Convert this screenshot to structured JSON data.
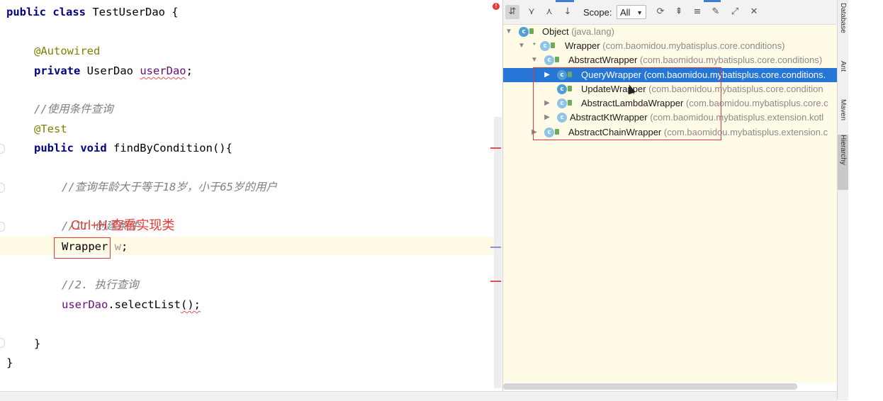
{
  "editor": {
    "lines": {
      "class_decl": {
        "kw": "public class ",
        "name": "TestUserDao {"
      },
      "autowired": "@Autowired",
      "field_decl": {
        "kw": "private ",
        "type": "UserDao ",
        "name": "userDao",
        "semi": ";"
      },
      "comment_use": "//使用条件查询",
      "test_ann": "@Test",
      "method_decl": {
        "kw": "public void ",
        "name": "findByCondition(){"
      },
      "comment_query": "//查询年龄大于等于18岁，小于65岁的用户",
      "comment_create": "//1. 创建条件",
      "wrapper_decl": {
        "type": "Wrapper",
        "var": " w",
        "semi": ";"
      },
      "comment_exec": "//2. 执行查询",
      "select_call": {
        "obj": "userDao",
        "dot": ".",
        "call": "selectList",
        "end": "();"
      },
      "method_close": "}",
      "class_close": "}"
    },
    "overlay_note": "Ctrl+H 查看实现类"
  },
  "hierarchy": {
    "toolbar": {
      "scope_label": "Scope:",
      "scope_value": "All"
    },
    "tree": [
      {
        "name": "Object",
        "pkg": "(java.lang)"
      },
      {
        "name": "Wrapper",
        "pkg": "(com.baomidou.mybatisplus.core.conditions)"
      },
      {
        "name": "AbstractWrapper",
        "pkg": "(com.baomidou.mybatisplus.core.conditions)"
      },
      {
        "name": "QueryWrapper",
        "pkg": "(com.baomidou.mybatisplus.core.conditions."
      },
      {
        "name": "UpdateWrapper",
        "pkg": "(com.baomidou.mybatisplus.core.condition"
      },
      {
        "name": "AbstractLambdaWrapper",
        "pkg": "(com.baomidou.mybatisplus.core.c"
      },
      {
        "name": "AbstractKtWrapper",
        "pkg": "(com.baomidou.mybatisplus.extension.kotl"
      },
      {
        "name": "AbstractChainWrapper",
        "pkg": "(com.baomidou.mybatisplus.extension.c"
      }
    ]
  },
  "side_tabs": [
    "Database",
    "Ant",
    "Maven",
    "Hierarchy"
  ]
}
